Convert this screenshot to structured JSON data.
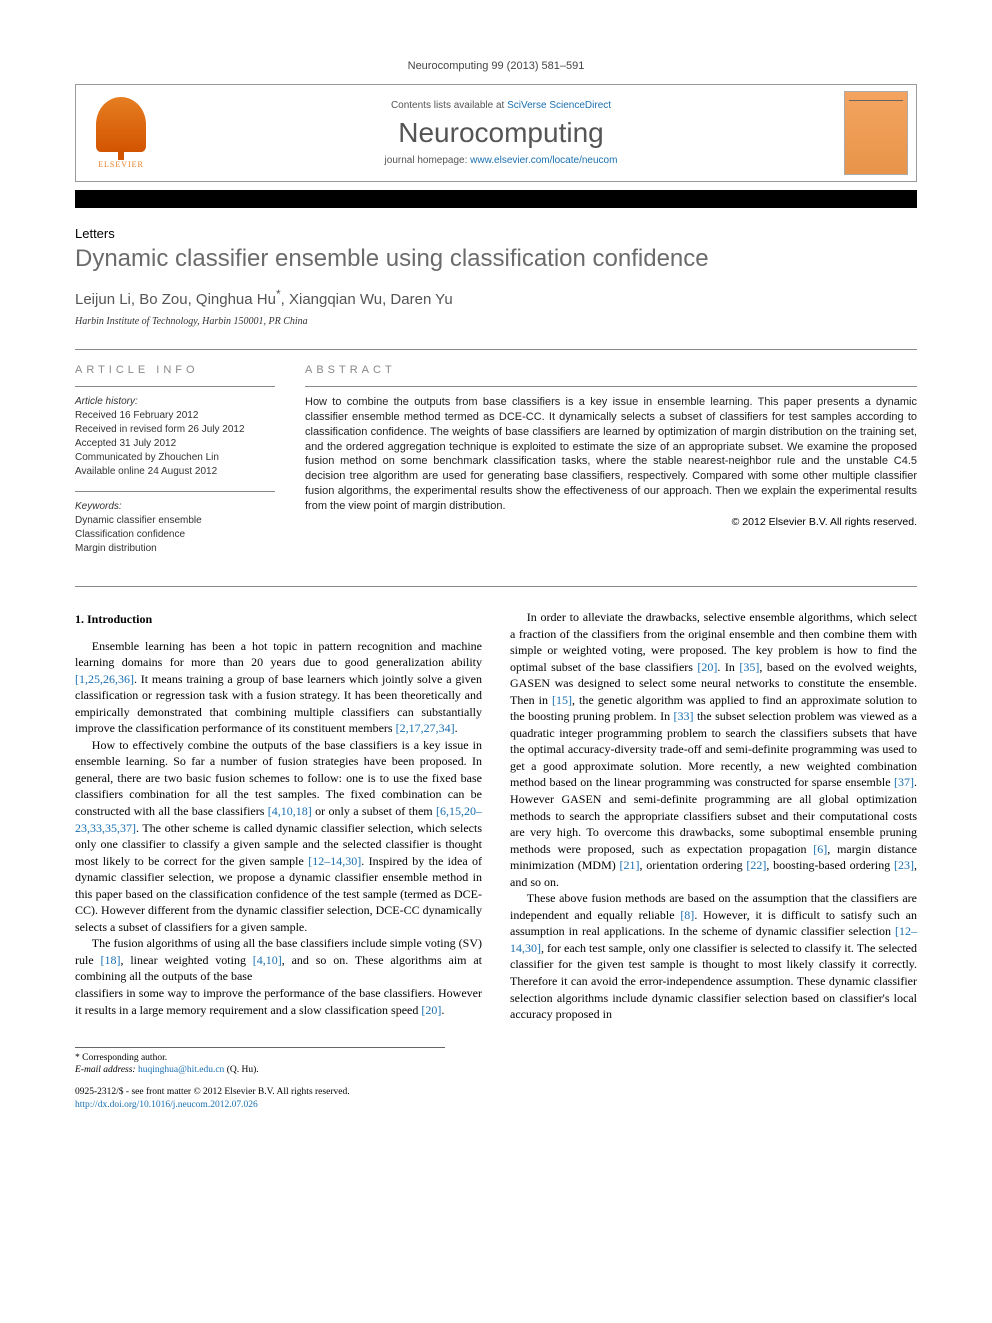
{
  "top_citation": "Neurocomputing 99 (2013) 581–591",
  "header": {
    "contents_prefix": "Contents lists available at ",
    "contents_link": "SciVerse ScienceDirect",
    "journal_name": "Neurocomputing",
    "homepage_prefix": "journal homepage: ",
    "homepage_link": "www.elsevier.com/locate/neucom",
    "publisher_name": "ELSEVIER"
  },
  "article": {
    "section_label": "Letters",
    "title": "Dynamic classifier ensemble using classification confidence",
    "authors_html": "Leijun Li, Bo Zou, Qinghua Hu",
    "authors_marker": "*",
    "authors_tail": ", Xiangqian Wu, Daren Yu",
    "affiliation": "Harbin Institute of Technology, Harbin 150001, PR China"
  },
  "info": {
    "heading": "ARTICLE INFO",
    "history_label": "Article history:",
    "received": "Received 16 February 2012",
    "revised": "Received in revised form 26 July 2012",
    "accepted": "Accepted 31 July 2012",
    "communicated": "Communicated by Zhouchen Lin",
    "online": "Available online 24 August 2012",
    "keywords_label": "Keywords:",
    "keywords": [
      "Dynamic classifier ensemble",
      "Classification confidence",
      "Margin distribution"
    ]
  },
  "abstract": {
    "heading": "ABSTRACT",
    "text": "How to combine the outputs from base classifiers is a key issue in ensemble learning. This paper presents a dynamic classifier ensemble method termed as DCE-CC. It dynamically selects a subset of classifiers for test samples according to classification confidence. The weights of base classifiers are learned by optimization of margin distribution on the training set, and the ordered aggregation technique is exploited to estimate the size of an appropriate subset. We examine the proposed fusion method on some benchmark classification tasks, where the stable nearest-neighbor rule and the unstable C4.5 decision tree algorithm are used for generating base classifiers, respectively. Compared with some other multiple classifier fusion algorithms, the experimental results show the effectiveness of our approach. Then we explain the experimental results from the view point of margin distribution.",
    "copyright": "© 2012 Elsevier B.V. All rights reserved."
  },
  "body": {
    "sec1_heading": "1. Introduction",
    "p1a": "Ensemble learning has been a hot topic in pattern recognition and machine learning domains for more than 20 years due to good generalization ability ",
    "p1r1": "[1,25,26,36]",
    "p1b": ". It means training a group of base learners which jointly solve a given classification or regression task with a fusion strategy. It has been theoretically and empirically demonstrated that combining multiple classifiers can substantially improve the classification performance of its constituent members ",
    "p1r2": "[2,17,27,34]",
    "p1c": ".",
    "p2a": "How to effectively combine the outputs of the base classifiers is a key issue in ensemble learning. So far a number of fusion strategies have been proposed. In general, there are two basic fusion schemes to follow: one is to use the fixed base classifiers combination for all the test samples. The fixed combination can be constructed with all the base classifiers ",
    "p2r1": "[4,10,18]",
    "p2b": " or only a subset of them ",
    "p2r2": "[6,15,20–23,33,35,37]",
    "p2c": ". The other scheme is called dynamic classifier selection, which selects only one classifier to classify a given sample and the selected classifier is thought most likely to be correct for the given sample ",
    "p2r3": "[12–14,30]",
    "p2d": ". Inspired by the idea of dynamic classifier selection, we propose a dynamic classifier ensemble method in this paper based on the classification confidence of the test sample (termed as DCE-CC). However different from the dynamic classifier selection, DCE-CC dynamically selects a subset of classifiers for a given sample.",
    "p3a": "The fusion algorithms of using all the base classifiers include simple voting (SV) rule ",
    "p3r1": "[18]",
    "p3b": ", linear weighted voting ",
    "p3r2": "[4,10]",
    "p3c": ", and so on. These algorithms aim at combining all the outputs of the base",
    "p4a": "classifiers in some way to improve the performance of the base classifiers. However it results in a large memory requirement and a slow classification speed ",
    "p4r1": "[20]",
    "p4b": ".",
    "p5a": "In order to alleviate the drawbacks, selective ensemble algorithms, which select a fraction of the classifiers from the original ensemble and then combine them with simple or weighted voting, were proposed. The key problem is how to find the optimal subset of the base classifiers ",
    "p5r1": "[20]",
    "p5b": ". In ",
    "p5r2": "[35]",
    "p5c": ", based on the evolved weights, GASEN was designed to select some neural networks to constitute the ensemble. Then in ",
    "p5r3": "[15]",
    "p5d": ", the genetic algorithm was applied to find an approximate solution to the boosting pruning problem. In ",
    "p5r4": "[33]",
    "p5e": " the subset selection problem was viewed as a quadratic integer programming problem to search the classifiers subsets that have the optimal accuracy-diversity trade-off and semi-definite programming was used to get a good approximate solution. More recently, a new weighted combination method based on the linear programming was constructed for sparse ensemble ",
    "p5r5": "[37]",
    "p5f": ". However GASEN and semi-definite programming are all global optimization methods to search the appropriate classifiers subset and their computational costs are very high. To overcome this drawbacks, some suboptimal ensemble pruning methods were proposed, such as expectation propagation ",
    "p5r6": "[6]",
    "p5g": ", margin distance minimization (MDM) ",
    "p5r7": "[21]",
    "p5h": ", orientation ordering ",
    "p5r8": "[22]",
    "p5i": ", boosting-based ordering ",
    "p5r9": "[23]",
    "p5j": ", and so on.",
    "p6a": "These above fusion methods are based on the assumption that the classifiers are independent and equally reliable ",
    "p6r1": "[8]",
    "p6b": ". However, it is difficult to satisfy such an assumption in real applications. In the scheme of dynamic classifier selection ",
    "p6r2": "[12–14,30]",
    "p6c": ", for each test sample, only one classifier is selected to classify it. The selected classifier for the given test sample is thought to most likely classify it correctly. Therefore it can avoid the error-independence assumption. These dynamic classifier selection algorithms include dynamic classifier selection based on classifier's local accuracy proposed in"
  },
  "footnote": {
    "corr_marker": "*",
    "corr_text": "Corresponding author.",
    "email_label": "E-mail address:",
    "email": "huqinghua@hit.edu.cn",
    "email_who": " (Q. Hu)."
  },
  "bottom": {
    "issn_line": "0925-2312/$ - see front matter © 2012 Elsevier B.V. All rights reserved.",
    "doi_line": "http://dx.doi.org/10.1016/j.neucom.2012.07.026"
  }
}
